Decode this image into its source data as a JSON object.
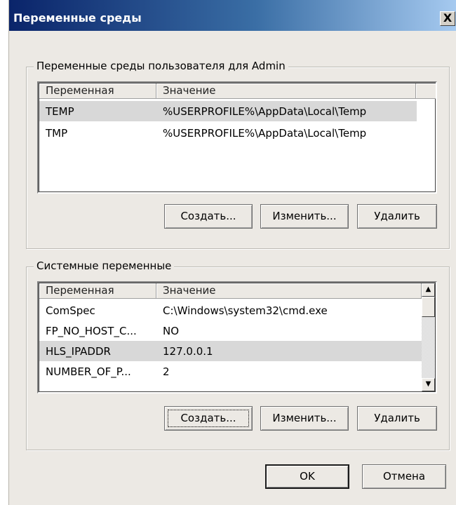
{
  "window": {
    "title": "Переменные среды",
    "close_label": "X"
  },
  "user_vars": {
    "group_label": "Переменные среды пользователя для Admin",
    "columns": [
      "Переменная",
      "Значение"
    ],
    "rows": [
      {
        "name": "TEMP",
        "value": "%USERPROFILE%\\AppData\\Local\\Temp",
        "selected": true
      },
      {
        "name": "TMP",
        "value": "%USERPROFILE%\\AppData\\Local\\Temp",
        "selected": false
      }
    ],
    "buttons": {
      "new": "Создать...",
      "edit": "Изменить...",
      "delete": "Удалить"
    }
  },
  "system_vars": {
    "group_label": "Системные переменные",
    "columns": [
      "Переменная",
      "Значение"
    ],
    "rows": [
      {
        "name": "ComSpec",
        "value": "C:\\Windows\\system32\\cmd.exe",
        "selected": false
      },
      {
        "name": "FP_NO_HOST_C...",
        "value": "NO",
        "selected": false
      },
      {
        "name": "HLS_IPADDR",
        "value": "127.0.0.1",
        "selected": true
      },
      {
        "name": "NUMBER_OF_P...",
        "value": "2",
        "selected": false
      }
    ],
    "buttons": {
      "new": "Создать...",
      "edit": "Изменить...",
      "delete": "Удалить"
    },
    "scrollbar": {
      "up_icon": "▲",
      "down_icon": "▼"
    }
  },
  "footer": {
    "ok": "OK",
    "cancel": "Отмена"
  }
}
